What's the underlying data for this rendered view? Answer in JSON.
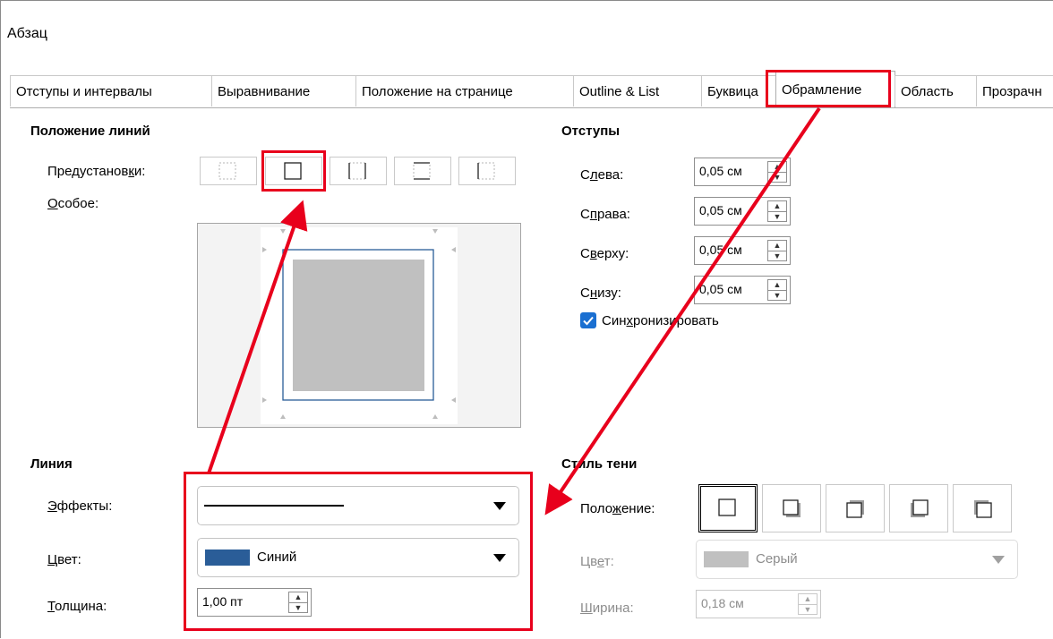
{
  "window": {
    "title": "Абзац"
  },
  "tabs": [
    {
      "label": "Отступы и интервалы",
      "active": false
    },
    {
      "label": "Выравнивание",
      "active": false
    },
    {
      "label": "Положение на странице",
      "active": false
    },
    {
      "label": "Outline & List",
      "active": false
    },
    {
      "label": "Буквица",
      "active": false
    },
    {
      "label": "Обрамление",
      "active": true
    },
    {
      "label": "Область",
      "active": false
    },
    {
      "label": "Прозрачн",
      "active": false
    }
  ],
  "line_arrangement": {
    "title": "Положение линий",
    "presets_label_before": "Предустанов",
    "presets_label_accel": "к",
    "presets_label_after": "и:",
    "custom_label_accel": "О",
    "custom_label_after": "собое:",
    "presets": [
      "no-border-icon",
      "all-borders-icon",
      "left-right-border-icon",
      "top-bottom-border-icon",
      "left-border-icon"
    ],
    "selected_preset": 1
  },
  "padding": {
    "title": "Отступы",
    "left_label_before": "С",
    "left_label_accel": "л",
    "left_label_after": "ева:",
    "left_value": "0,05 см",
    "right_label_before": "С",
    "right_label_accel": "п",
    "right_label_after": "рава:",
    "right_value": "0,05 см",
    "top_label_before": "С",
    "top_label_accel": "в",
    "top_label_after": "ерху:",
    "top_value": "0,05 см",
    "bottom_label_before": "С",
    "bottom_label_accel": "н",
    "bottom_label_after": "изу:",
    "bottom_value": "0,05 см",
    "sync_label_before": "Син",
    "sync_label_accel": "х",
    "sync_label_after": "ронизировать",
    "sync_checked": true
  },
  "line": {
    "title": "Линия",
    "effects_label_accel": "Э",
    "effects_label_after": "ффекты:",
    "color_label_accel": "Ц",
    "color_label_after": "вет:",
    "color_value": "Синий",
    "color_swatch": "#2a5d98",
    "width_label_accel": "Т",
    "width_label_after": "олщина:",
    "width_value": "1,00 пт"
  },
  "shadow": {
    "title": "Стиль тени",
    "position_label_before": "Поло",
    "position_label_accel": "ж",
    "position_label_after": "ение:",
    "positions": [
      "no-shadow-icon",
      "shadow-bottom-right-icon",
      "shadow-top-right-icon",
      "shadow-bottom-left-icon",
      "shadow-top-left-icon"
    ],
    "selected_position": 0,
    "color_label_before": "Цв",
    "color_label_accel": "е",
    "color_label_after": "т:",
    "color_value": "Серый",
    "color_swatch": "#c0c0c0",
    "distance_label_accel": "Ш",
    "distance_label_after": "ирина:",
    "distance_value": "0,18 см"
  },
  "colors": {
    "highlight": "#e8001c",
    "checkbox": "#1a6fd1",
    "preview_border": "#2a5d98"
  }
}
